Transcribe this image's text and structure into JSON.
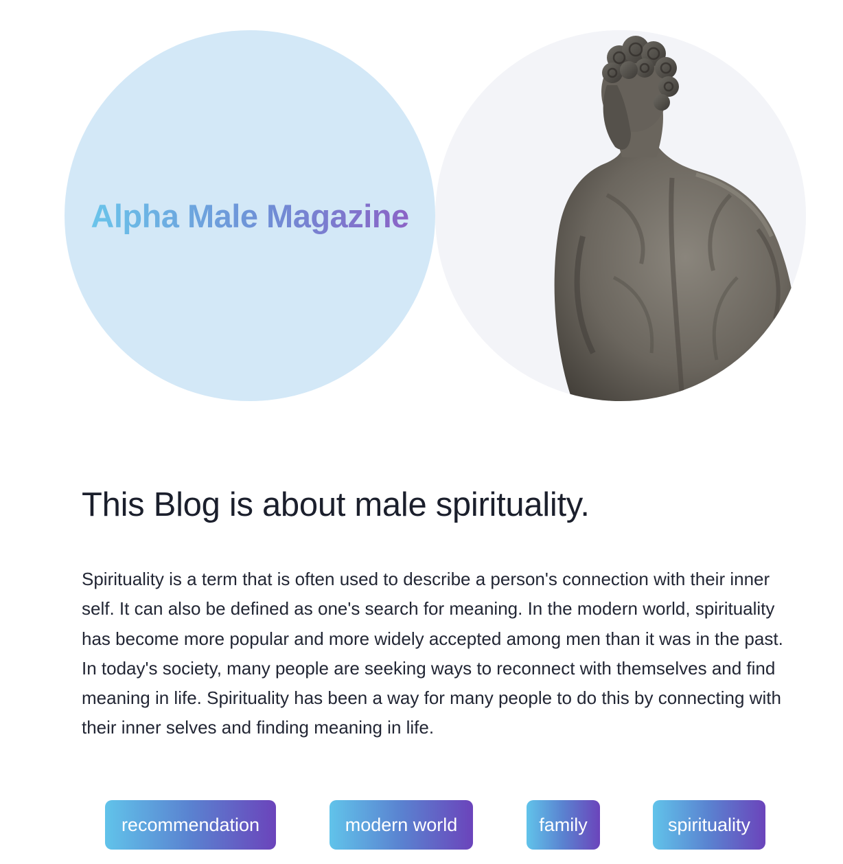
{
  "hero": {
    "site_title": "Alpha Male Magazine",
    "image_subject": "statue-back-image",
    "left_circle_color": "#d3e8f7",
    "title_gradient": [
      "#6ac4ea",
      "#6f8fd6",
      "#8b63c6"
    ]
  },
  "article": {
    "heading": "This Blog is about male spirituality.",
    "body": "Spirituality is a term that is often used to describe a person's connection with their inner self. It can also be defined as one's search for meaning. In the modern world, spirituality has become more popular and more widely accepted among men than it was in the past. In today's society, many people are seeking ways to reconnect with themselves and find meaning in life. Spirituality has been a way for many people to do this by connecting with their inner selves and finding meaning in life."
  },
  "tags": {
    "items": [
      {
        "label": "recommendation"
      },
      {
        "label": "modern world"
      },
      {
        "label": "family"
      },
      {
        "label": "spirituality"
      }
    ],
    "gradient": [
      "#61c3ea",
      "#5a82d0",
      "#6b44bb"
    ]
  }
}
